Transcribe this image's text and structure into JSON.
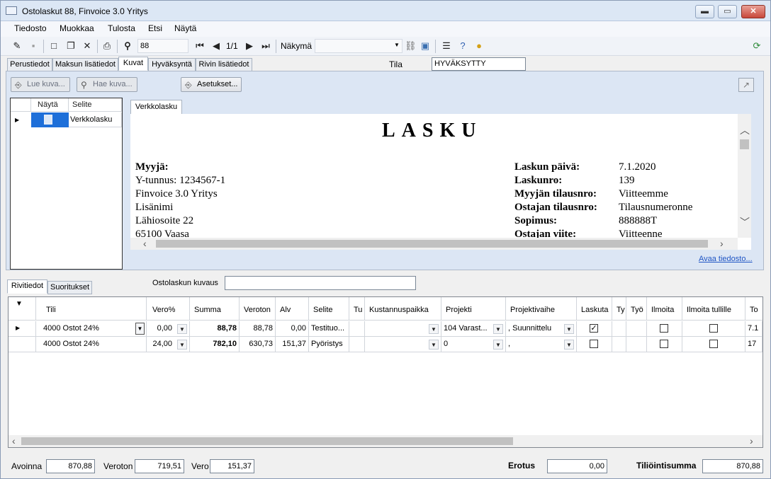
{
  "window": {
    "title": "Ostolaskut 88, Finvoice 3.0 Yritys",
    "min": "▬",
    "max": "▭",
    "close": "✕"
  },
  "menu": [
    "Tiedosto",
    "Muokkaa",
    "Tulosta",
    "Etsi",
    "Näytä"
  ],
  "toolbar": {
    "search_value": "88",
    "record_pos": "1/1",
    "view_label": "Näkymä",
    "view_value": ""
  },
  "tabs_top": [
    "Perustiedot",
    "Maksun lisätiedot",
    "Kuvat",
    "Hyväksyntä",
    "Rivin lisätiedot"
  ],
  "tila": {
    "label": "Tila",
    "value": "HYVÄKSYTTY"
  },
  "image_panel": {
    "buttons": {
      "read": "Lue kuva...",
      "fetch": "Hae kuva...",
      "settings": "Asetukset..."
    },
    "list_headers": [
      "Näytä",
      "Selite"
    ],
    "list_rows": [
      {
        "selite": "Verkkolasku"
      }
    ],
    "doc_tab": "Verkkolasku",
    "open_file": "Avaa tiedosto..."
  },
  "invoice": {
    "heading": "LASKU",
    "seller_label": "Myyjä:",
    "seller_lines": [
      "Y-tunnus: 1234567-1",
      "Finvoice 3.0 Yritys",
      "Lisänimi",
      "Lähiosoite 22",
      "65100 Vaasa"
    ],
    "fields": [
      {
        "label": "Laskun päivä:",
        "value": "7.1.2020"
      },
      {
        "label": "Laskunro:",
        "value": "139"
      },
      {
        "label": "Myyjän tilausnro:",
        "value": "Viitteemme"
      },
      {
        "label": "Ostajan tilausnro:",
        "value": "Tilausnumeronne"
      },
      {
        "label": "Sopimus:",
        "value": "888888T"
      },
      {
        "label": "Ostajan viite:",
        "value": "Viitteenne"
      }
    ]
  },
  "lower_tabs": [
    "Rivitiedot",
    "Suoritukset"
  ],
  "description": {
    "label": "Ostolaskun kuvaus",
    "value": ""
  },
  "grid": {
    "headers": [
      "Tili",
      "Vero%",
      "Summa",
      "Veroton",
      "Alv",
      "Selite",
      "Tu",
      "Kustannuspaikka",
      "Projekti",
      "Projektivaihe",
      "Laskuta",
      "Ty",
      "Työ",
      "Ilmoita",
      "Ilmoita tullille",
      "To"
    ],
    "rows": [
      {
        "tili": "4000 Ostot 24%",
        "vero": "0,00",
        "summa": "88,78",
        "veroton": "88,78",
        "alv": "0,00",
        "selite": "Testituo...",
        "tu": "",
        "kustannus": "",
        "projekti": "104 Varast...",
        "vaihe": ", Suunnittelu",
        "laskuta": true,
        "ilmoita": false,
        "tullille": false,
        "to": "7.1"
      },
      {
        "tili": "4000 Ostot 24%",
        "vero": "24,00",
        "summa": "782,10",
        "veroton": "630,73",
        "alv": "151,37",
        "selite": "Pyöristys",
        "tu": "",
        "kustannus": "",
        "projekti": "0",
        "vaihe": ",",
        "laskuta": false,
        "ilmoita": false,
        "tullille": false,
        "to": "17"
      }
    ]
  },
  "footer": {
    "avoinna": {
      "label": "Avoinna",
      "value": "870,88"
    },
    "veroton": {
      "label": "Veroton",
      "value": "719,51"
    },
    "vero": {
      "label": "Vero",
      "value": "151,37"
    },
    "erotus": {
      "label": "Erotus",
      "value": "0,00"
    },
    "tiliointi": {
      "label": "Tiliöintisumma",
      "value": "870,88"
    }
  }
}
